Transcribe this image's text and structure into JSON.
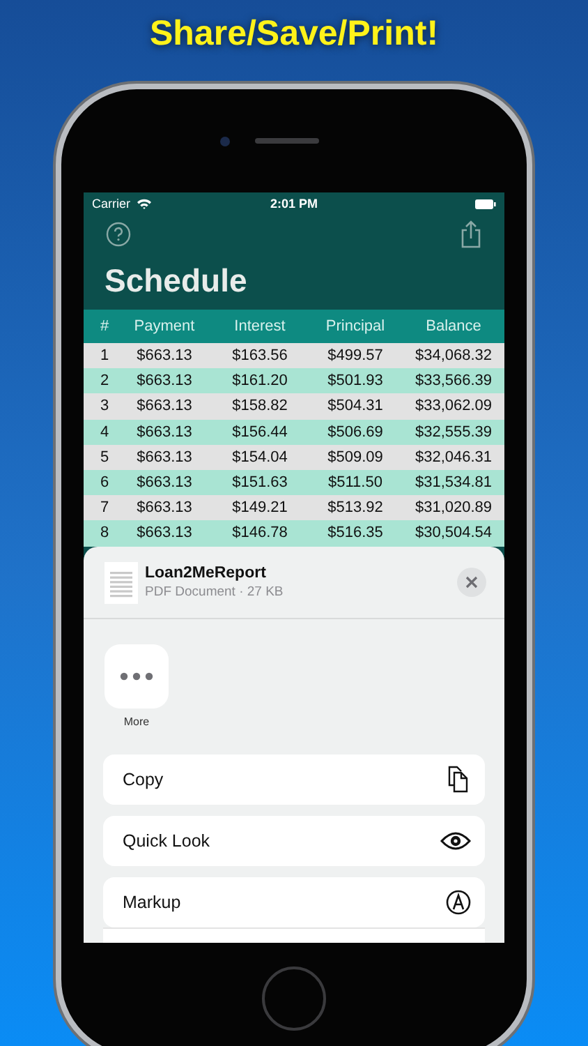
{
  "headline": "Share/Save/Print!",
  "status_bar": {
    "carrier": "Carrier",
    "time": "2:01 PM"
  },
  "title": "Schedule",
  "table": {
    "columns": [
      "#",
      "Payment",
      "Interest",
      "Principal",
      "Balance"
    ],
    "rows": [
      [
        "1",
        "$663.13",
        "$163.56",
        "$499.57",
        "$34,068.32"
      ],
      [
        "2",
        "$663.13",
        "$161.20",
        "$501.93",
        "$33,566.39"
      ],
      [
        "3",
        "$663.13",
        "$158.82",
        "$504.31",
        "$33,062.09"
      ],
      [
        "4",
        "$663.13",
        "$156.44",
        "$506.69",
        "$32,555.39"
      ],
      [
        "5",
        "$663.13",
        "$154.04",
        "$509.09",
        "$32,046.31"
      ],
      [
        "6",
        "$663.13",
        "$151.63",
        "$511.50",
        "$31,534.81"
      ],
      [
        "7",
        "$663.13",
        "$149.21",
        "$513.92",
        "$31,020.89"
      ],
      [
        "8",
        "$663.13",
        "$146.78",
        "$516.35",
        "$30,504.54"
      ]
    ]
  },
  "share_sheet": {
    "file_name": "Loan2MeReport",
    "file_info": "PDF Document · 27 KB",
    "apps": [
      {
        "label": "More"
      }
    ],
    "actions": [
      {
        "label": "Copy",
        "kind": "copy"
      },
      {
        "label": "Quick Look",
        "kind": "quicklook"
      },
      {
        "label": "Markup",
        "kind": "markup"
      }
    ]
  }
}
